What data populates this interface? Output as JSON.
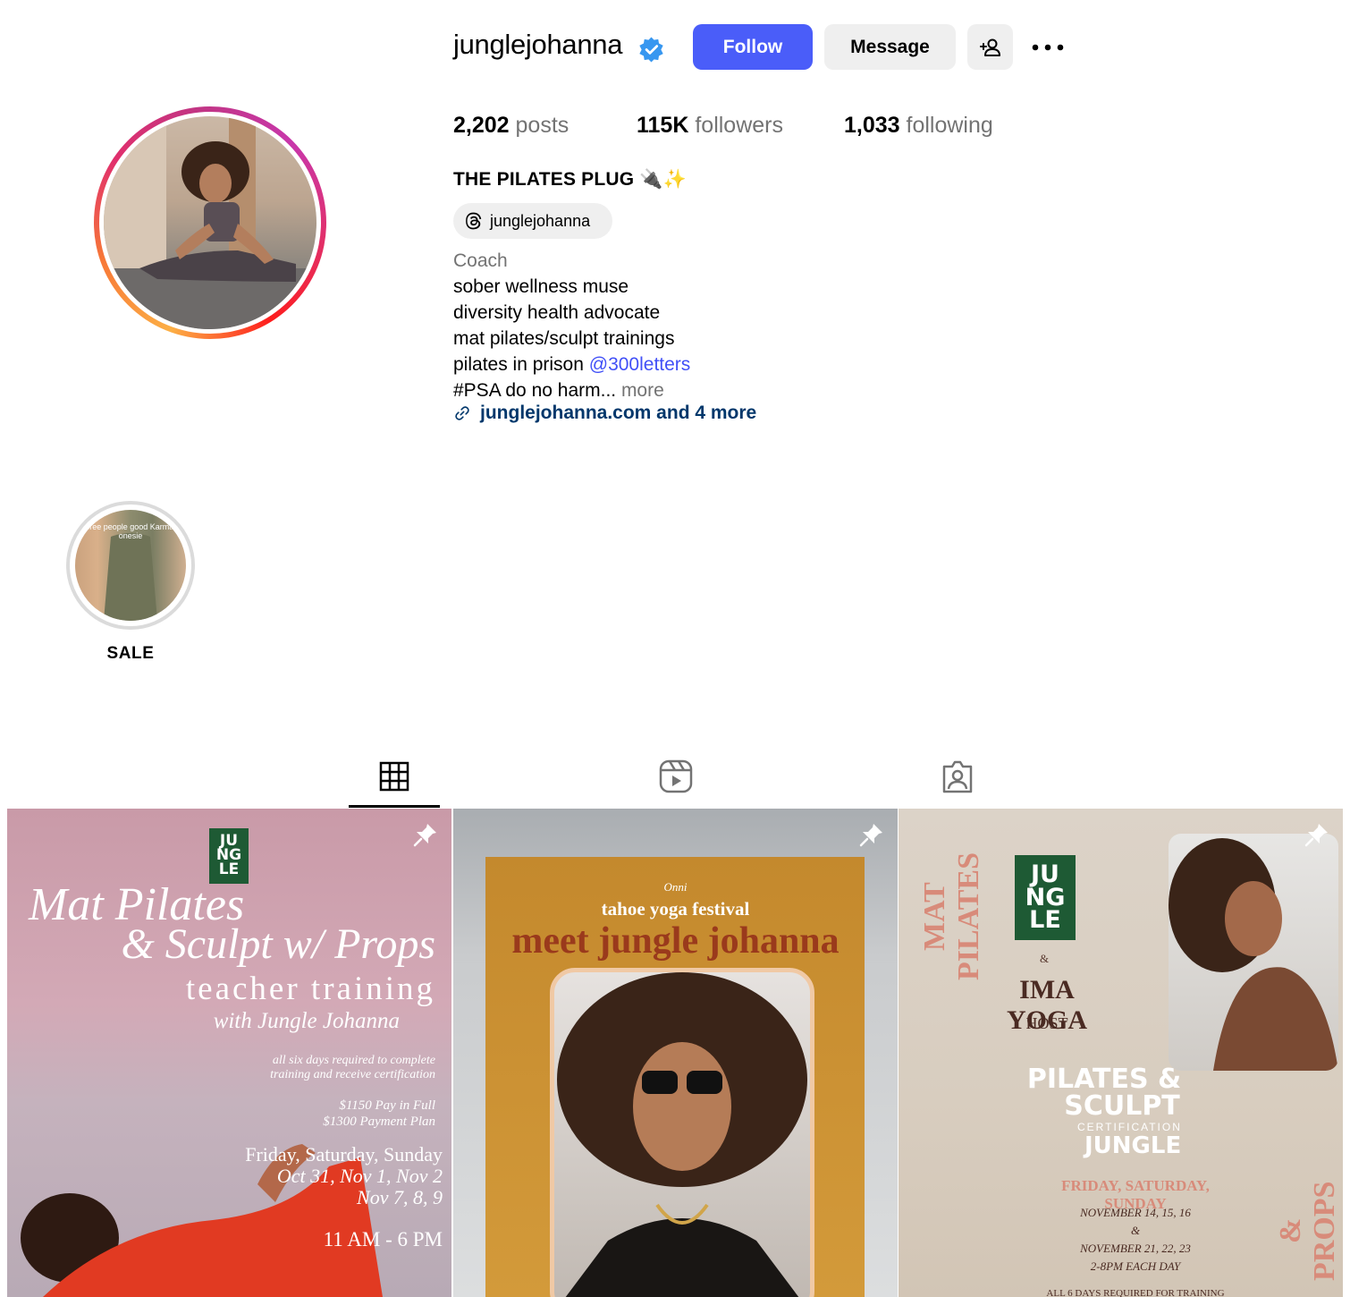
{
  "profile": {
    "username": "junglejohanna",
    "verified": true,
    "follow_label": "Follow",
    "message_label": "Message",
    "stats": {
      "posts_count": "2,202",
      "posts_label": "posts",
      "followers_count": "115K",
      "followers_label": "followers",
      "following_count": "1,033",
      "following_label": "following"
    },
    "full_name": "THE PILATES PLUG 🔌✨",
    "threads_handle": "junglejohanna",
    "category": "Coach",
    "bio_lines": [
      "sober wellness muse",
      "diversity health advocate",
      "mat pilates/sculpt trainings",
      "pilates in prison "
    ],
    "bio_mention": "@300letters",
    "bio_last": "#PSA do no harm...",
    "bio_more": " more",
    "link_text": "junglejohanna.com and 4 more"
  },
  "highlights": [
    {
      "label": "SALE",
      "cover_text": "free people good Karma onesie"
    }
  ],
  "posts": [
    {
      "logo": [
        "JU",
        "NG",
        "LE"
      ],
      "title1": "Mat Pilates",
      "title2": "& Sculpt w/ Props",
      "title3": "teacher training",
      "title4": "with Jungle Johanna",
      "note": "all six days required to complete training and receive certification",
      "price1": "$1150 Pay in Full",
      "price2": "$1300 Payment Plan",
      "days": "Friday, Saturday, Sunday",
      "dates1": "Oct 31, Nov 1, Nov 2",
      "dates2": "Nov 7, 8, 9",
      "time": "11 AM - 6 PM"
    },
    {
      "brand": "Onni",
      "festival": "tahoe yoga festival",
      "headline": "meet jungle johanna"
    },
    {
      "side_left": "MAT PILATES",
      "logo": [
        "JU",
        "NG",
        "LE"
      ],
      "amp": "&",
      "studio": "IMA YOGA",
      "host": "HOST",
      "cert1": "PILATES &",
      "cert2": "SCULPT",
      "cert3": "CERTIFICATION",
      "cert4": "JUNGLE",
      "days": "FRIDAY, SATURDAY, SUNDAY",
      "dates1": "NOVEMBER 14, 15, 16",
      "amp2": "&",
      "dates2": "NOVEMBER 21, 22, 23",
      "time": "2-8PM EACH DAY",
      "footer": "ALL 6 DAYS REQUIRED FOR TRAINING",
      "side_right": "& PROPS"
    }
  ],
  "colors": {
    "follow_button": "#4a5df9",
    "mention": "#4150f7",
    "link": "#00376b",
    "verified_badge": "#3797f0",
    "jungle_logo": "#1e5a34"
  }
}
